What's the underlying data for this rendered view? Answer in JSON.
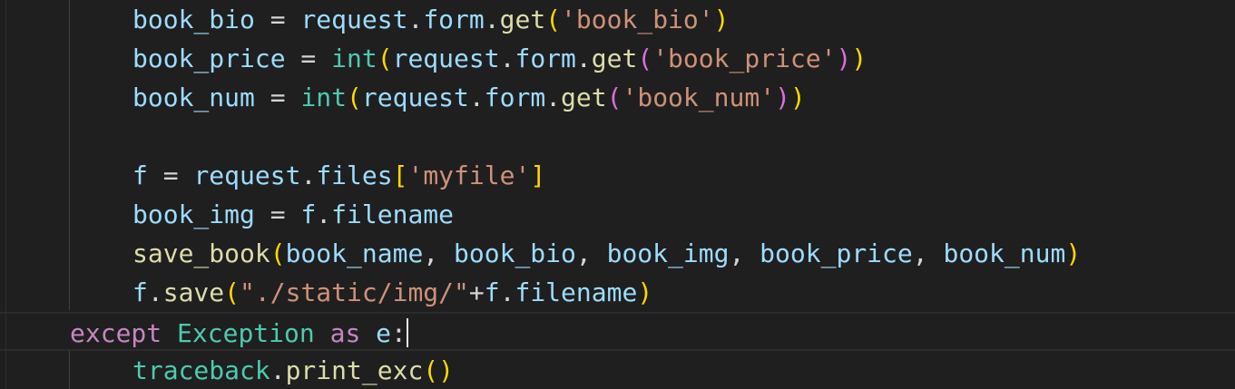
{
  "editor": {
    "theme_colors": {
      "background": "#1f1f1f",
      "variable": "#9cdcfe",
      "function": "#dcdcaa",
      "class": "#4ec9b0",
      "string": "#ce9178",
      "keyword": "#c586c0",
      "bracket_level1": "#ffd700",
      "bracket_level2": "#da70d6"
    },
    "lines": [
      {
        "tokens": [
          {
            "t": "book_bio",
            "c": "var"
          },
          {
            "t": " = ",
            "c": "op"
          },
          {
            "t": "request",
            "c": "var"
          },
          {
            "t": ".",
            "c": "punc"
          },
          {
            "t": "form",
            "c": "var"
          },
          {
            "t": ".",
            "c": "punc"
          },
          {
            "t": "get",
            "c": "fn"
          },
          {
            "t": "(",
            "c": "b1"
          },
          {
            "t": "'book_bio'",
            "c": "str"
          },
          {
            "t": ")",
            "c": "b1"
          }
        ]
      },
      {
        "tokens": [
          {
            "t": "book_price",
            "c": "var"
          },
          {
            "t": " = ",
            "c": "op"
          },
          {
            "t": "int",
            "c": "cls"
          },
          {
            "t": "(",
            "c": "b1"
          },
          {
            "t": "request",
            "c": "var"
          },
          {
            "t": ".",
            "c": "punc"
          },
          {
            "t": "form",
            "c": "var"
          },
          {
            "t": ".",
            "c": "punc"
          },
          {
            "t": "get",
            "c": "fn"
          },
          {
            "t": "(",
            "c": "b2"
          },
          {
            "t": "'book_price'",
            "c": "str"
          },
          {
            "t": ")",
            "c": "b2"
          },
          {
            "t": ")",
            "c": "b1"
          }
        ]
      },
      {
        "tokens": [
          {
            "t": "book_num",
            "c": "var"
          },
          {
            "t": " = ",
            "c": "op"
          },
          {
            "t": "int",
            "c": "cls"
          },
          {
            "t": "(",
            "c": "b1"
          },
          {
            "t": "request",
            "c": "var"
          },
          {
            "t": ".",
            "c": "punc"
          },
          {
            "t": "form",
            "c": "var"
          },
          {
            "t": ".",
            "c": "punc"
          },
          {
            "t": "get",
            "c": "fn"
          },
          {
            "t": "(",
            "c": "b2"
          },
          {
            "t": "'book_num'",
            "c": "str"
          },
          {
            "t": ")",
            "c": "b2"
          },
          {
            "t": ")",
            "c": "b1"
          }
        ]
      },
      {
        "tokens": []
      },
      {
        "tokens": [
          {
            "t": "f",
            "c": "var"
          },
          {
            "t": " = ",
            "c": "op"
          },
          {
            "t": "request",
            "c": "var"
          },
          {
            "t": ".",
            "c": "punc"
          },
          {
            "t": "files",
            "c": "var"
          },
          {
            "t": "[",
            "c": "b1"
          },
          {
            "t": "'myfile'",
            "c": "str"
          },
          {
            "t": "]",
            "c": "b1"
          }
        ]
      },
      {
        "tokens": [
          {
            "t": "book_img",
            "c": "var"
          },
          {
            "t": " = ",
            "c": "op"
          },
          {
            "t": "f",
            "c": "var"
          },
          {
            "t": ".",
            "c": "punc"
          },
          {
            "t": "filename",
            "c": "var"
          }
        ]
      },
      {
        "tokens": [
          {
            "t": "save_book",
            "c": "fn"
          },
          {
            "t": "(",
            "c": "b1"
          },
          {
            "t": "book_name",
            "c": "var"
          },
          {
            "t": ", ",
            "c": "punc"
          },
          {
            "t": "book_bio",
            "c": "var"
          },
          {
            "t": ", ",
            "c": "punc"
          },
          {
            "t": "book_img",
            "c": "var"
          },
          {
            "t": ", ",
            "c": "punc"
          },
          {
            "t": "book_price",
            "c": "var"
          },
          {
            "t": ", ",
            "c": "punc"
          },
          {
            "t": "book_num",
            "c": "var"
          },
          {
            "t": ")",
            "c": "b1"
          }
        ]
      },
      {
        "tokens": [
          {
            "t": "f",
            "c": "var"
          },
          {
            "t": ".",
            "c": "punc"
          },
          {
            "t": "save",
            "c": "fn"
          },
          {
            "t": "(",
            "c": "b1"
          },
          {
            "t": "\"./static/img/\"",
            "c": "str"
          },
          {
            "t": "+",
            "c": "op"
          },
          {
            "t": "f",
            "c": "var"
          },
          {
            "t": ".",
            "c": "punc"
          },
          {
            "t": "filename",
            "c": "var"
          },
          {
            "t": ")",
            "c": "b1"
          }
        ]
      },
      {
        "current": true,
        "tokens": [
          {
            "t": "except",
            "c": "kw"
          },
          {
            "t": " ",
            "c": "op"
          },
          {
            "t": "Exception",
            "c": "cls"
          },
          {
            "t": " ",
            "c": "op"
          },
          {
            "t": "as",
            "c": "kw"
          },
          {
            "t": " ",
            "c": "op"
          },
          {
            "t": "e",
            "c": "var"
          },
          {
            "t": ":",
            "c": "punc"
          }
        ]
      },
      {
        "tokens": [
          {
            "t": "traceback",
            "c": "cls"
          },
          {
            "t": ".",
            "c": "punc"
          },
          {
            "t": "print_exc",
            "c": "fn"
          },
          {
            "t": "(",
            "c": "b1"
          },
          {
            "t": ")",
            "c": "b1"
          }
        ]
      }
    ]
  }
}
